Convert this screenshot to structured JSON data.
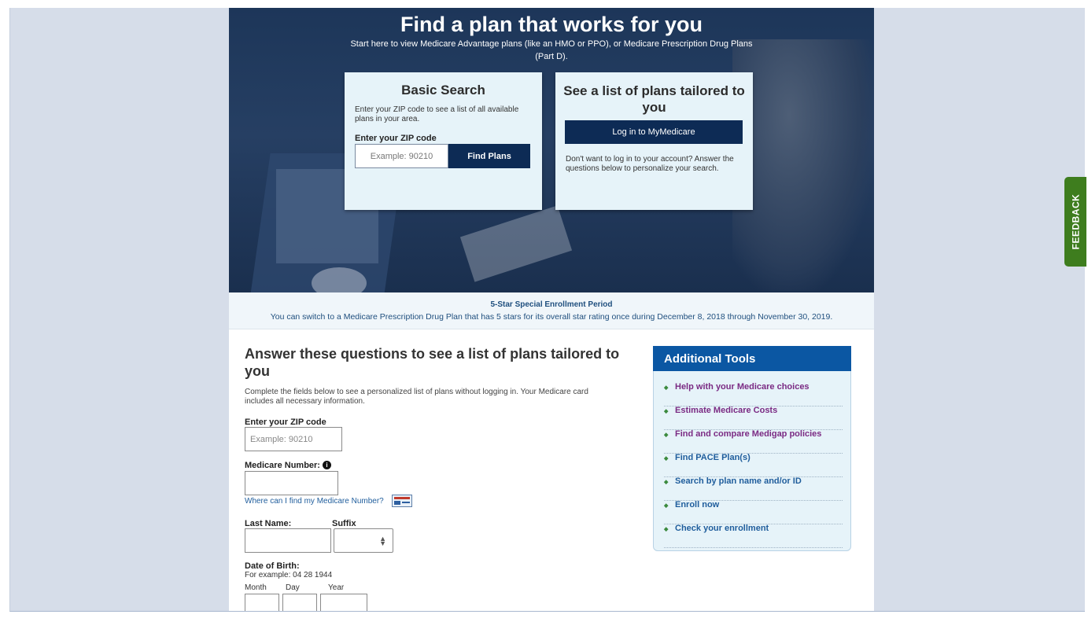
{
  "hero": {
    "title": "Find a plan that works for you",
    "subtitle": "Start here to view Medicare Advantage plans (like an HMO or PPO), or Medicare Prescription Drug Plans (Part D)."
  },
  "basic_search": {
    "title": "Basic Search",
    "description": "Enter your ZIP code to see a list of all available plans in your area.",
    "zip_label": "Enter your ZIP code",
    "zip_placeholder": "Example: 90210",
    "button": "Find Plans"
  },
  "tailored": {
    "title": "See a list of plans tailored to you",
    "login_button": "Log in to MyMedicare",
    "description": "Don't want to log in to your account? Answer the questions below to personalize your search."
  },
  "enrollment_banner": {
    "title": "5-Star Special Enrollment Period",
    "text": "You can switch to a Medicare Prescription Drug Plan that has 5 stars for its overall star rating once during December 8, 2018 through November 30, 2019."
  },
  "questions": {
    "title": "Answer these questions to see a list of plans tailored to you",
    "description": "Complete the fields below to see a personalized list of plans without logging in. Your Medicare card includes all necessary information.",
    "zip_label": "Enter your ZIP code",
    "zip_placeholder": "Example: 90210",
    "medicare_number_label": "Medicare Number:",
    "medicare_number_help": "Where can I find my Medicare Number?",
    "last_name_label": "Last Name:",
    "suffix_label": "Suffix",
    "dob_label": "Date of Birth:",
    "dob_example": "For example: 04 28 1944",
    "month_label": "Month",
    "day_label": "Day",
    "year_label": "Year"
  },
  "tools": {
    "title": "Additional Tools",
    "items": [
      {
        "label": "Help with your Medicare choices",
        "color": "#7a2a83"
      },
      {
        "label": "Estimate Medicare Costs",
        "color": "#7a2a83"
      },
      {
        "label": "Find and compare Medigap policies",
        "color": "#7a2a83"
      },
      {
        "label": "Find PACE Plan(s)",
        "color": "#1f5d9c"
      },
      {
        "label": "Search by plan name and/or ID",
        "color": "#1f5d9c"
      },
      {
        "label": "Enroll now",
        "color": "#1f5d9c"
      },
      {
        "label": "Check your enrollment",
        "color": "#1f5d9c"
      }
    ]
  },
  "feedback": {
    "label": "FEEDBACK",
    "color": "#3e7d1e"
  },
  "icons": {
    "info": "info-icon",
    "medicare_card": "medicare-card-icon",
    "select_arrows": "select-arrows-icon",
    "bullet": "diamond-bullet-icon"
  }
}
